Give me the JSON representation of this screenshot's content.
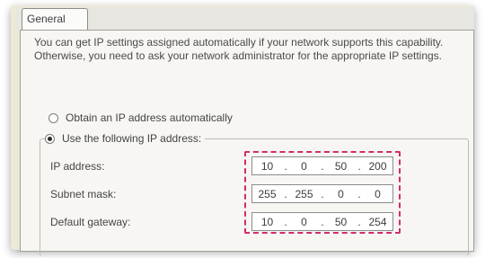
{
  "tabs": [
    {
      "label": "General",
      "active": true
    }
  ],
  "description": "You can get IP settings assigned automatically if your network supports this capability. Otherwise, you need to ask your network administrator for the appropriate IP settings.",
  "radio_auto": {
    "label": "Obtain an IP address automatically",
    "checked": false
  },
  "radio_manual": {
    "label": "Use the following IP address:",
    "checked": true
  },
  "fields": {
    "ip": {
      "label": "IP address:",
      "octets": [
        "10",
        "0",
        "50",
        "200"
      ]
    },
    "subnet": {
      "label": "Subnet mask:",
      "octets": [
        "255",
        "255",
        "0",
        "0"
      ]
    },
    "gateway": {
      "label": "Default gateway:",
      "octets": [
        "10",
        "0",
        "50",
        "254"
      ]
    }
  },
  "colors": {
    "highlight": "#d12d6b",
    "dialog_bg": "#f7f6f3"
  }
}
